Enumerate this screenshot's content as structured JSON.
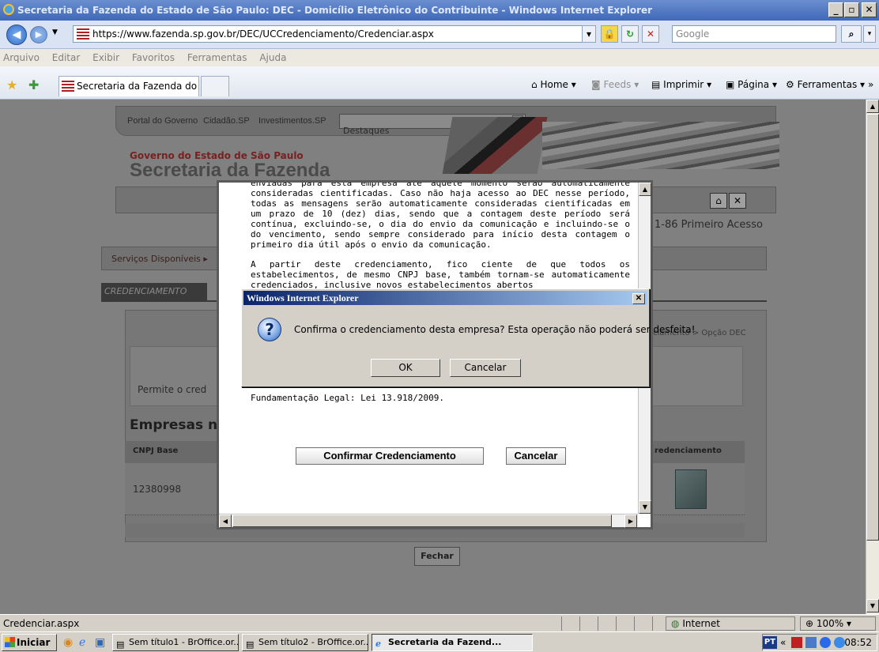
{
  "window": {
    "title": "Secretaria da Fazenda do Estado de São Paulo: DEC - Domicílio Eletrônico do Contribuinte - Windows Internet Explorer",
    "minimize": "_",
    "maximize": "▫",
    "close": "✕"
  },
  "address": {
    "url": "https://www.fazenda.sp.gov.br/DEC/UCCredenciamento/Credenciar.aspx",
    "search_placeholder": "Google"
  },
  "menu": [
    "Arquivo",
    "Editar",
    "Exibir",
    "Favoritos",
    "Ferramentas",
    "Ajuda"
  ],
  "tab": {
    "label": "Secretaria da Fazenda do Estado de São Paulo: DEC -..."
  },
  "commands": {
    "home": "Home",
    "feeds": "Feeds",
    "print": "Imprimir",
    "page": "Página",
    "tools": "Ferramentas"
  },
  "page": {
    "portal_links": [
      "Portal do Governo",
      "Cidadão.SP",
      "Investimentos.SP"
    ],
    "destaques": "Destaques",
    "gov_label": "Governo do Estado de São Paulo",
    "secretaria": "Secretaria da Fazenda",
    "primeiro_acesso": "1-86  Primeiro Acesso",
    "servicos": "Serviços Disponíveis ▸",
    "credenciamento_tab": "CREDENCIAMENTO",
    "breadcrumb": "ciamento > Opção DEC",
    "permite": "Permite o cred",
    "empresas": "Empresas nã",
    "col_cnpj": "CNPJ Base",
    "col_cred": "redenciamento",
    "cnpj_value": "12380998",
    "fechar": "Fechar"
  },
  "dialog": {
    "paragraph1": "enviadas para esta empresa até aquele momento serão automaticamente consideradas cientificadas. Caso não haja acesso ao DEC nesse período, todas as mensagens serão automaticamente consideradas cientificadas em um prazo de 10 (dez) dias, sendo que a contagem deste período será contínua, excluindo-se, o dia do envio da comunicação e incluindo-se o do vencimento, sendo sempre considerado para início desta contagem o primeiro dia útil após o envio da comunicação.",
    "paragraph2": "A partir deste credenciamento, fico ciente de que todos os estabelecimentos, de mesmo CNPJ base, também tornam-se automaticamente credenciados, inclusive novos estabelecimentos abertos",
    "fundamentacao": "Fundamentação Legal: Lei 13.918/2009.",
    "confirm_button": "Confirmar Credenciamento",
    "cancel_button": "Cancelar"
  },
  "msgbox": {
    "title": "Windows Internet Explorer",
    "message": "Confirma o credenciamento desta empresa? Esta operação não poderá ser desfeita!",
    "ok": "OK",
    "cancel": "Cancelar",
    "close": "✕"
  },
  "status": {
    "text": "Credenciar.aspx",
    "zone": "Internet",
    "zoom": "100%"
  },
  "taskbar": {
    "start": "Iniciar",
    "items": [
      "Sem título1 - BrOffice.or...",
      "Sem título2 - BrOffice.or...",
      "Secretaria da Fazend..."
    ],
    "lang": "PT",
    "clock": "08:52"
  }
}
